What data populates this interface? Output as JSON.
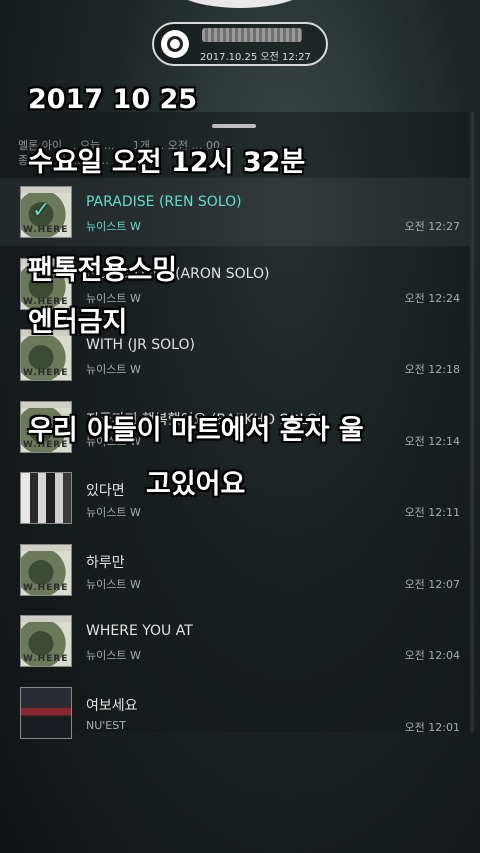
{
  "status_pill": {
    "time_text": "2017.10.25 오전 12:27"
  },
  "notice": {
    "lines": [
      "멜론 아이 … 오늘 … … 1개 … 오전 … 00 …",
      "종류 … 다 … 보 …"
    ]
  },
  "songs": [
    {
      "title": "PARADISE (REN SOLO)",
      "artist": "뉴이스트 W",
      "time": "오전 12:27",
      "art": "album",
      "active": true
    },
    {
      "title": "GOOD LOVE (ARON SOLO)",
      "artist": "뉴이스트 W",
      "time": "오전 12:24",
      "art": "album",
      "active": false
    },
    {
      "title": "WITH (JR SOLO)",
      "artist": "뉴이스트 W",
      "time": "오전 12:18",
      "art": "album",
      "active": false
    },
    {
      "title": "지금까지 행복했어요 (BAEKHO SOLO)",
      "artist": "뉴이스트 W",
      "time": "오전 12:14",
      "art": "album",
      "active": false
    },
    {
      "title": "있다면",
      "artist": "뉴이스트 W",
      "time": "오전 12:11",
      "art": "bw",
      "active": false
    },
    {
      "title": "하루만",
      "artist": "뉴이스트 W",
      "time": "오전 12:07",
      "art": "album",
      "active": false
    },
    {
      "title": "WHERE YOU AT",
      "artist": "뉴이스트 W",
      "time": "오전 12:04",
      "art": "album",
      "active": false
    },
    {
      "title": "여보세요",
      "artist": "NU'EST",
      "time": "오전 12:01",
      "art": "red",
      "active": false
    }
  ],
  "overlay_text": {
    "date": "2017 10 25",
    "day_time": "수요일 오전 12시 32분",
    "line1": "팬톡전용스밍",
    "line2": "엔터금지",
    "line3": "우리 아들이 마트에서 혼자 울",
    "line4": "고있어요"
  },
  "colors": {
    "accent": "#5fe0c8"
  },
  "icons": {
    "check": "check-icon",
    "app": "disc-icon"
  }
}
